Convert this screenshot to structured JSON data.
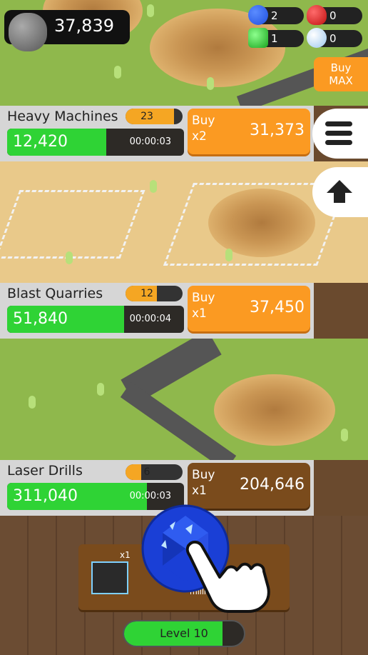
{
  "currency": {
    "icon": "stone-icon",
    "amount": "37,839"
  },
  "gems": [
    {
      "icon": "blue-gem-icon",
      "count": "2",
      "color": "#1e4fe0"
    },
    {
      "icon": "red-gem-icon",
      "count": "0",
      "color": "#e02020"
    },
    {
      "icon": "green-gem-icon",
      "count": "1",
      "color": "#2fd335"
    },
    {
      "icon": "diamond-icon",
      "count": "0",
      "color": "#cfe8ff"
    }
  ],
  "buy_max": {
    "line1": "Buy",
    "line2": "MAX"
  },
  "businesses": [
    {
      "name": "Heavy Machines",
      "level": "23",
      "level_progress": 0.85,
      "income": "12,420",
      "income_progress": 0.56,
      "timer": "00:00:03",
      "buy_label": "Buy",
      "buy_mult": "x2",
      "price": "31,373",
      "affordable": true
    },
    {
      "name": "Blast Quarries",
      "level": "12",
      "level_progress": 0.55,
      "income": "51,840",
      "income_progress": 0.66,
      "timer": "00:00:04",
      "buy_label": "Buy",
      "buy_mult": "x1",
      "price": "37,450",
      "affordable": true
    },
    {
      "name": "Laser Drills",
      "level": "6",
      "level_progress": 0.28,
      "income": "311,040",
      "income_progress": 0.79,
      "timer": "00:00:03",
      "buy_label": "Buy",
      "buy_mult": "x1",
      "price": "204,646",
      "affordable": false
    }
  ],
  "side_buttons": [
    {
      "icon": "menu-icon"
    },
    {
      "icon": "arrow-up-icon"
    }
  ],
  "tutorial": {
    "multiplier": "x1",
    "subtext": "millio",
    "gem_icon": "blue-gem-icon",
    "hand_icon": "pointing-hand-icon"
  },
  "player_level": {
    "label": "Level 10",
    "progress": 0.82
  }
}
